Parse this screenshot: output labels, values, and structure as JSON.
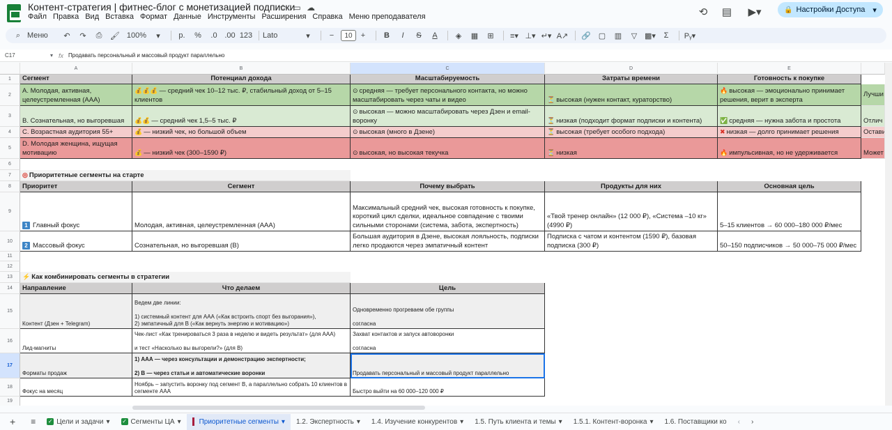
{
  "app": {
    "title": "Контент-стратегия | фитнес-блог с монетизацией подписки",
    "menu": [
      "Файл",
      "Правка",
      "Вид",
      "Вставка",
      "Формат",
      "Данные",
      "Инструменты",
      "Расширения",
      "Справка",
      "Меню преподавателя"
    ],
    "share_label": "Настройки Доступа"
  },
  "toolbar": {
    "search": "Меню",
    "zoom": "100%",
    "currency": "р.",
    "percent": "%",
    "dec_less": ".0",
    "dec_more": ".00",
    "format123": "123",
    "font": "Lato",
    "font_size": "10",
    "bold": "B",
    "italic": "I",
    "strike": "S",
    "textcolor": "A",
    "sum": "Σ"
  },
  "formula_bar": {
    "cell_ref": "C17",
    "fx": "fx",
    "content": "Продавать персональный и массовый продукт параллельно"
  },
  "columns": [
    "A",
    "B",
    "C",
    "D",
    "E"
  ],
  "rows": [
    "1",
    "2",
    "3",
    "4",
    "5",
    "6",
    "7",
    "8",
    "9",
    "10",
    "11",
    "12",
    "13",
    "14",
    "15",
    "16",
    "17",
    "18",
    "19"
  ],
  "table1": {
    "headers": [
      "Сегмент",
      "Потенциал дохода",
      "Масштабируемость",
      "Затраты времени",
      "Готовность к покупке"
    ],
    "r2": [
      "A. Молодая, активная, целеустремленная (ААА)",
      "— средний чек 10–12 тыс. ₽, стабильный доход от 5–15 клиентов",
      "средняя — требует персонального контакта, но можно масштабировать через чаты и видео",
      "высокая (нужен контакт, кураторство)",
      "высокая — эмоционально принимает решения, верит в эксперта",
      "Лучши"
    ],
    "r3": [
      "B. Сознательная, но выгоревшая",
      "— средний чек 1,5–5 тыс. ₽",
      "высокая — можно масштабировать через Дзен и email-воронку",
      "низкая (подходит формат подписки и контента)",
      "средняя — нужна забота и простота",
      "Отлич"
    ],
    "r4": [
      "C. Возрастная аудитория 55+",
      "— низкий чек, но большой объем",
      "высокая (много в Дзене)",
      "высокая (требует особого подхода)",
      "низкая — долго принимает решения",
      "Остави"
    ],
    "r5": [
      "D. Молодая женщина, ищущая мотивацию",
      "— низкий чек (300–1590 ₽)",
      "высокая, но высокая текучка",
      "низкая",
      "импульсивная, но не удерживается",
      "Может"
    ]
  },
  "section2": {
    "title": "Приоритетные сегменты на старте",
    "headers": [
      "Приоритет",
      "Сегмент",
      "Почему выбрать",
      "Продукты для них",
      "Основная цель"
    ],
    "r9": [
      "Главный фокус",
      "Молодая, активная, целеустремленная (ААА)",
      "Максимальный средний чек, высокая готовность к покупке, короткий цикл сделки, идеальное совпадение с твоими сильными сторонами (система, забота, экспертность)",
      "«Твой тренер онлайн» (12 000 ₽), «Система –10 кг» (4990 ₽)",
      "5–15 клиентов → 60 000–180 000 ₽/мес"
    ],
    "r10": [
      "Массовый фокус",
      "Сознательная, но выгоревшая (B)",
      "Большая аудитория в Дзене, высокая лояльность, подписки легко продаются через эмпатичный контент",
      "Подписка с чатом и контентом (1590 ₽), базовая подписка (300 ₽)",
      "50–150 подписчиков → 50 000–75 000 ₽/мес"
    ],
    "badge1": "1",
    "badge2": "2"
  },
  "section3": {
    "title": "Как комбинировать сегменты в стратегии",
    "headers": [
      "Направление",
      "Что делаем",
      "Цель"
    ],
    "r15": [
      "Контент (Дзен + Telegram)",
      "Ведем две линии:\n\n1) системный контент для ААА («Как встроить спорт без выгорания»),\n2) эмпатичный для B («Как вернуть энергию и мотивацию»)",
      "Одновременно прогреваем обе группы\n\nсогласна"
    ],
    "r16": [
      "Лид-магниты",
      "Чек-лист «Как тренироваться 3 раза в неделю и видеть результат» (для ААА)\n\nи тест «Насколько вы выгорели?» (для B)",
      "Захват контактов и запуск автоворонки\n\nсогласна"
    ],
    "r17": [
      "Форматы продаж",
      "1) ААА — через консультации и демонстрацию экспертности;\n\n2) B — через статьи и автоматические воронки",
      "Продавать персональный и массовый продукт параллельно"
    ],
    "r18": [
      "Фокус на месяц",
      "Ноябрь – запустить воронку под сегмент B, а параллельно собрать 10 клиентов в сегменте ААА",
      "Быстро выйти на 60 000–120 000 ₽"
    ]
  },
  "tabs": [
    "Цели и задачи",
    "Сегменты ЦА",
    "Приоритетные сегменты",
    "1.2. Экспертность",
    "1.4. Изучение конкурентов",
    "1.5. Путь клиента и темы",
    "1.5.1. Контент-воронка",
    "1.6. Поставщики ко"
  ],
  "colors": {
    "green": "#b6d7a8",
    "light_green": "#d9ead3",
    "pink": "#f4cccc",
    "red": "#ea9999",
    "header_gray": "#d0cece",
    "accent": "#0b57d0"
  }
}
